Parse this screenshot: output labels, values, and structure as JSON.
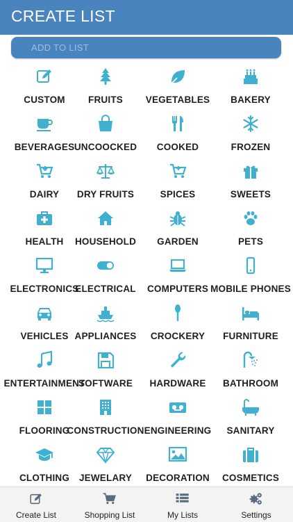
{
  "header": {
    "title": "CREATE LIST"
  },
  "add_input": {
    "placeholder": "ADD TO LIST"
  },
  "colors": {
    "brand": "#4a84bf",
    "icon": "#3fb0cf",
    "label": "#1f1f1f",
    "nav_icon": "#5a6b80"
  },
  "categories": [
    {
      "label": "CUSTOM",
      "icon": "edit-icon"
    },
    {
      "label": "FRUITS",
      "icon": "tree-icon"
    },
    {
      "label": "VEGETABLES",
      "icon": "leaf-icon"
    },
    {
      "label": "BAKERY",
      "icon": "cake-icon"
    },
    {
      "label": "BEVERAGES",
      "icon": "cup-icon"
    },
    {
      "label": "UNCOOCKED",
      "icon": "shopping-bag-icon"
    },
    {
      "label": "COOKED",
      "icon": "utensils-icon"
    },
    {
      "label": "FROZEN",
      "icon": "snowflake-icon"
    },
    {
      "label": "DAIRY",
      "icon": "cart-download-icon"
    },
    {
      "label": "DRY FRUITS",
      "icon": "balance-scale-icon"
    },
    {
      "label": "SPICES",
      "icon": "cart-plus-icon"
    },
    {
      "label": "SWEETS",
      "icon": "gift-icon"
    },
    {
      "label": "HEALTH",
      "icon": "medkit-icon"
    },
    {
      "label": "HOUSEHOLD",
      "icon": "home-icon"
    },
    {
      "label": "GARDEN",
      "icon": "bug-icon"
    },
    {
      "label": "PETS",
      "icon": "paw-icon"
    },
    {
      "label": "ELECTRONICS",
      "icon": "monitor-icon"
    },
    {
      "label": "ELECTRICAL",
      "icon": "toggle-icon"
    },
    {
      "label": "COMPUTERS",
      "icon": "laptop-icon"
    },
    {
      "label": "MOBILE PHONES",
      "icon": "mobile-icon"
    },
    {
      "label": "VEHICLES",
      "icon": "car-icon"
    },
    {
      "label": "APPLIANCES",
      "icon": "ship-icon"
    },
    {
      "label": "CROCKERY",
      "icon": "spoon-icon"
    },
    {
      "label": "FURNITURE",
      "icon": "bed-icon"
    },
    {
      "label": "ENTERTAINMENT",
      "icon": "music-icon"
    },
    {
      "label": "SOFTWARE",
      "icon": "floppy-disk-icon"
    },
    {
      "label": "HARDWARE",
      "icon": "wrench-icon"
    },
    {
      "label": "BATHROOM",
      "icon": "shower-icon"
    },
    {
      "label": "FLOORING",
      "icon": "grid-tiles-icon"
    },
    {
      "label": "CONSTRUCTION",
      "icon": "building-icon"
    },
    {
      "label": "ENGINEERING",
      "icon": "tape-icon"
    },
    {
      "label": "SANITARY",
      "icon": "bathtub-icon"
    },
    {
      "label": "CLOTHING",
      "icon": "graduation-cap-icon"
    },
    {
      "label": "JEWELARY",
      "icon": "diamond-icon"
    },
    {
      "label": "DECORATION",
      "icon": "picture-icon"
    },
    {
      "label": "COSMETICS",
      "icon": "suitcase-icon"
    }
  ],
  "bottom_nav": [
    {
      "label": "Create List",
      "icon": "edit-icon"
    },
    {
      "label": "Shopping List",
      "icon": "cart-icon"
    },
    {
      "label": "My Lists",
      "icon": "list-icon"
    },
    {
      "label": "Settings",
      "icon": "gears-icon"
    }
  ]
}
